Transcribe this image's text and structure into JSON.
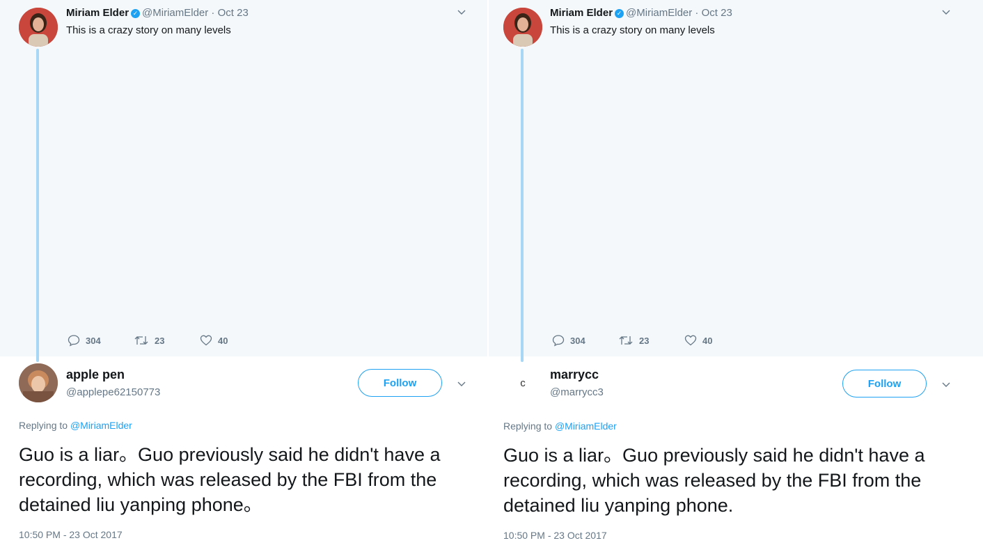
{
  "panels": [
    {
      "parent_tweet": {
        "author_name": "Miriam Elder",
        "handle_date": "@MiriamElder · Oct 23",
        "text": "This is a crazy story on many levels",
        "replies": "304",
        "retweets": "23",
        "likes": "40"
      },
      "reply": {
        "author_name": "apple pen",
        "handle": "@applepe62150773",
        "avatar_letter": "",
        "follow_label": "Follow",
        "replying_prefix": "Replying to ",
        "replying_to": "@MiriamElder",
        "text": "Guo is a liar。Guo previously said he didn't have a recording, which was released by the FBI from the detained liu yanping phone。",
        "timestamp": "10:50 PM - 23 Oct 2017",
        "bottom_cutoff_text": ""
      }
    },
    {
      "parent_tweet": {
        "author_name": "Miriam Elder",
        "handle_date": "@MiriamElder · Oct 23",
        "text": "This is a crazy story on many levels",
        "replies": "304",
        "retweets": "23",
        "likes": "40"
      },
      "reply": {
        "author_name": "marrycc",
        "handle": "@marrycc3",
        "avatar_letter": "c",
        "follow_label": "Follow",
        "replying_prefix": "Replying to ",
        "replying_to": "@MiriamElder",
        "text": "Guo is a liar。Guo previously said he didn't have a recording, which was released by the FBI from the detained liu yanping phone.",
        "timestamp": "10:50 PM - 23 Oct 2017",
        "bottom_cutoff_text": ""
      }
    }
  ],
  "colors": {
    "accent": "#1da1f2",
    "thread_line": "#a7d7f5",
    "parent_bg": "#f5f8fa",
    "muted_text": "#657786"
  }
}
